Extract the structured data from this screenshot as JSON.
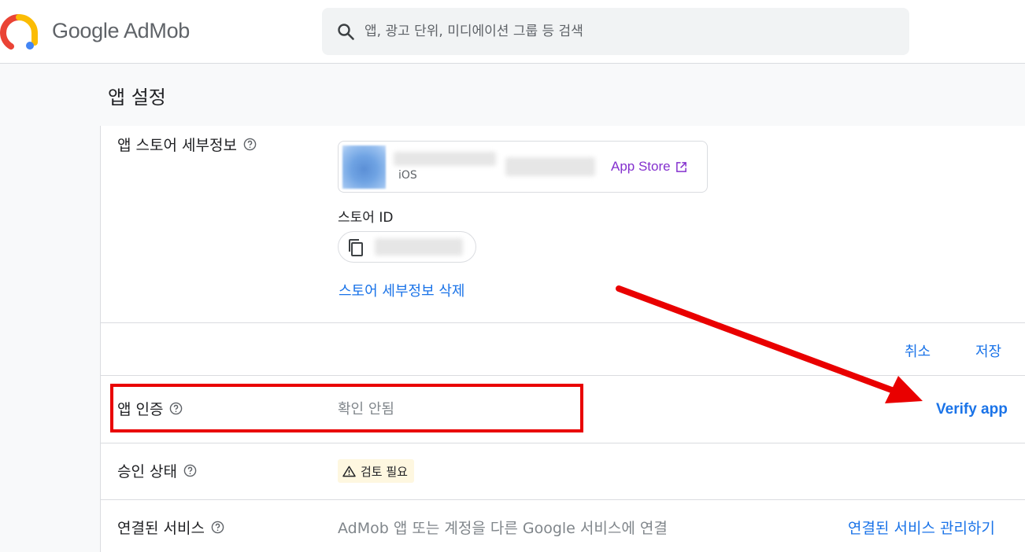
{
  "header": {
    "brand": "Google AdMob",
    "search_placeholder": "앱, 광고 단위, 미디에이션 그룹 등 검색"
  },
  "page": {
    "title": "앱 설정"
  },
  "store_details": {
    "label": "앱 스토어 세부정보",
    "platform": "iOS",
    "store_link": "App Store",
    "store_id_label": "스토어 ID",
    "delete_link": "스토어 세부정보 삭제"
  },
  "actions": {
    "cancel": "취소",
    "save": "저장"
  },
  "verification": {
    "label": "앱 인증",
    "status": "확인 안됨",
    "verify_button": "Verify app"
  },
  "approval": {
    "label": "승인 상태",
    "badge": "검토 필요"
  },
  "connected": {
    "label": "연결된 서비스",
    "description": "AdMob 앱 또는 계정을 다른 Google 서비스에 연결",
    "manage_link": "연결된 서비스 관리하기"
  },
  "colors": {
    "link_blue": "#1a73e8",
    "app_store_purple": "#8430ce",
    "annotation_red": "#e90000",
    "badge_bg": "#fef7e0"
  }
}
